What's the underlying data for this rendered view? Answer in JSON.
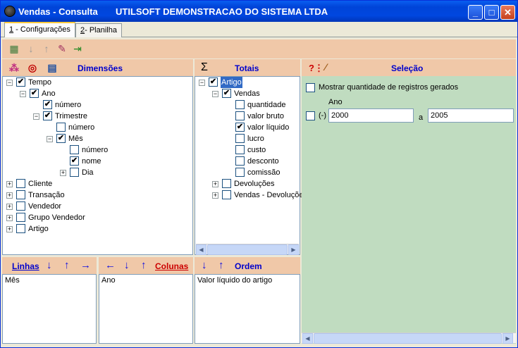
{
  "window": {
    "title": "Vendas - Consulta",
    "company": "UTILSOFT DEMONSTRACAO DO SISTEMA LTDA"
  },
  "tabs": [
    {
      "key": "1",
      "label": " - Configurações"
    },
    {
      "key": "2",
      "label": "- Planilha"
    }
  ],
  "sections": {
    "dimensions": "Dimensões",
    "totals_symbol": "Σ",
    "totals": "Totais",
    "selection": "Seleção",
    "rows": "Linhas",
    "columns": "Colunas",
    "order": "Ordem"
  },
  "dimensions_tree": [
    {
      "label": "Tempo",
      "level": 0,
      "expander": "−",
      "checked": true
    },
    {
      "label": "Ano",
      "level": 1,
      "expander": "−",
      "checked": true
    },
    {
      "label": "número",
      "level": 2,
      "expander": "",
      "checked": true
    },
    {
      "label": "Trimestre",
      "level": 2,
      "expander": "−",
      "checked": true
    },
    {
      "label": "número",
      "level": 3,
      "expander": "",
      "checked": false
    },
    {
      "label": "Mês",
      "level": 3,
      "expander": "−",
      "checked": true
    },
    {
      "label": "número",
      "level": 4,
      "expander": "",
      "checked": false
    },
    {
      "label": "nome",
      "level": 4,
      "expander": "",
      "checked": true
    },
    {
      "label": "Dia",
      "level": 4,
      "expander": "+",
      "checked": false
    },
    {
      "label": "Cliente",
      "level": 0,
      "expander": "+",
      "checked": false
    },
    {
      "label": "Transação",
      "level": 0,
      "expander": "+",
      "checked": false
    },
    {
      "label": "Vendedor",
      "level": 0,
      "expander": "+",
      "checked": false
    },
    {
      "label": "Grupo Vendedor",
      "level": 0,
      "expander": "+",
      "checked": false
    },
    {
      "label": "Artigo",
      "level": 0,
      "expander": "+",
      "checked": false
    }
  ],
  "totals_tree": [
    {
      "label": "Artigo",
      "level": 0,
      "expander": "−",
      "checked": true,
      "selected": true
    },
    {
      "label": "Vendas",
      "level": 1,
      "expander": "−",
      "checked": true
    },
    {
      "label": "quantidade",
      "level": 2,
      "expander": "",
      "checked": false
    },
    {
      "label": "valor bruto",
      "level": 2,
      "expander": "",
      "checked": false
    },
    {
      "label": "valor líquido",
      "level": 2,
      "expander": "",
      "checked": true
    },
    {
      "label": "lucro",
      "level": 2,
      "expander": "",
      "checked": false
    },
    {
      "label": "custo",
      "level": 2,
      "expander": "",
      "checked": false
    },
    {
      "label": "desconto",
      "level": 2,
      "expander": "",
      "checked": false
    },
    {
      "label": "comissão",
      "level": 2,
      "expander": "",
      "checked": false
    },
    {
      "label": "Devoluções",
      "level": 1,
      "expander": "+",
      "checked": false
    },
    {
      "label": "Vendas - Devoluções",
      "level": 1,
      "expander": "+",
      "checked": false
    }
  ],
  "rows_list": [
    "Mês"
  ],
  "columns_list": [
    "Ano"
  ],
  "order_list": [
    "Valor líquido do artigo"
  ],
  "selection": {
    "show_count_label": "Mostrar quantidade de registros gerados",
    "field_label": "Ano",
    "neg_label": "(-)",
    "from": "2000",
    "sep": "a",
    "to": "2005"
  },
  "colors": {
    "panel_header": "#f0c8a8",
    "selection_bg": "#c0dcc0",
    "header_text": "#0000cc",
    "columns_text": "#cc0000"
  }
}
